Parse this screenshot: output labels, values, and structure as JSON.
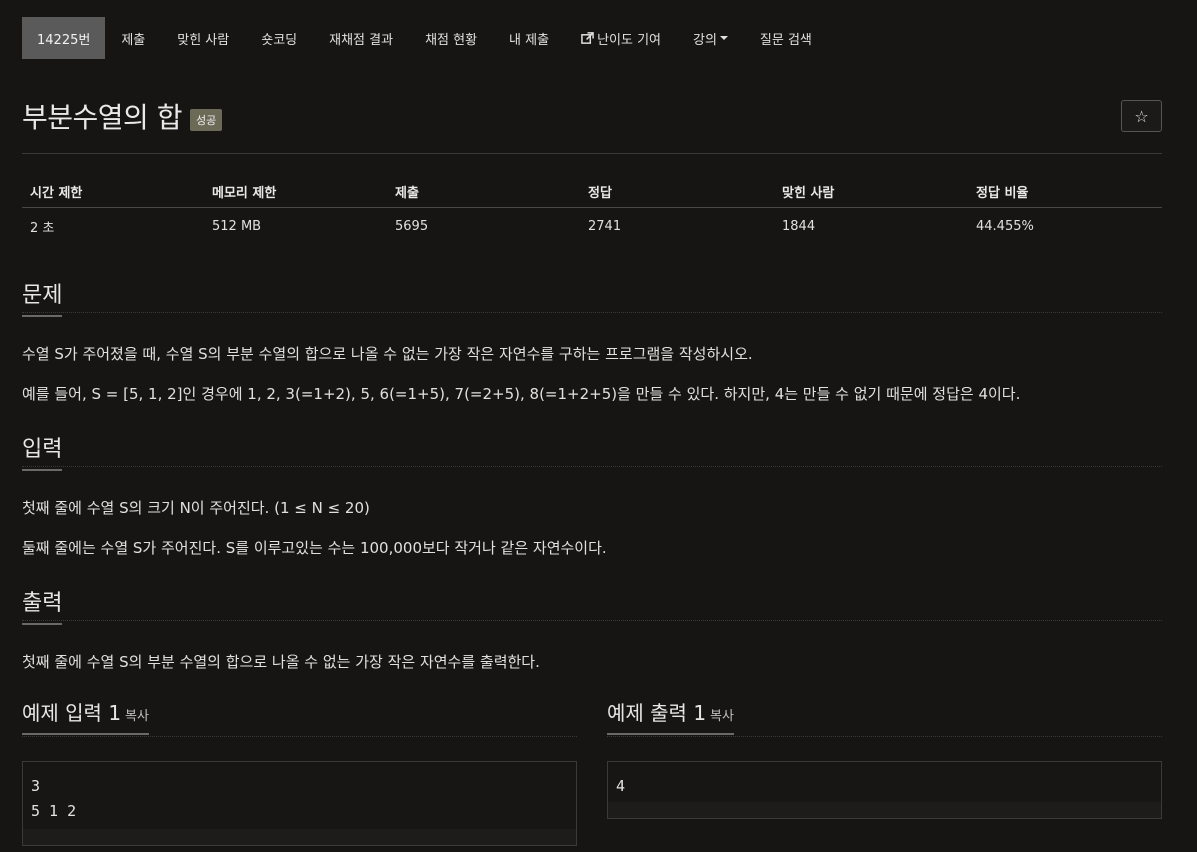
{
  "nav": {
    "items": [
      {
        "label": "14225번"
      },
      {
        "label": "제출"
      },
      {
        "label": "맞힌 사람"
      },
      {
        "label": "숏코딩"
      },
      {
        "label": "재채점 결과"
      },
      {
        "label": "채점 현황"
      },
      {
        "label": "내 제출"
      },
      {
        "label": "난이도 기여",
        "icon": "external-link-icon"
      },
      {
        "label": "강의",
        "icon": "caret-down-icon"
      },
      {
        "label": "질문 검색"
      }
    ]
  },
  "problem": {
    "title": "부분수열의 합",
    "badge": "성공",
    "star_icon": "☆"
  },
  "stats": {
    "headers": [
      "시간 제한",
      "메모리 제한",
      "제출",
      "정답",
      "맞힌 사람",
      "정답 비율"
    ],
    "values": [
      "2 초",
      "512 MB",
      "5695",
      "2741",
      "1844",
      "44.455%"
    ]
  },
  "sections": {
    "description": {
      "heading": "문제",
      "paragraphs": [
        "수열 S가 주어졌을 때, 수열 S의 부분 수열의 합으로 나올 수 없는 가장 작은 자연수를 구하는 프로그램을 작성하시오.",
        "예를 들어, S = [5, 1, 2]인 경우에 1, 2, 3(=1+2), 5, 6(=1+5), 7(=2+5), 8(=1+2+5)을 만들 수 있다. 하지만, 4는 만들 수 없기 때문에 정답은 4이다."
      ]
    },
    "input": {
      "heading": "입력",
      "paragraphs": [
        "첫째 줄에 수열 S의 크기 N이 주어진다. (1 ≤ N ≤ 20)",
        "둘째 줄에는 수열 S가 주어진다. S를 이루고있는 수는 100,000보다 작거나 같은 자연수이다."
      ]
    },
    "output": {
      "heading": "출력",
      "paragraphs": [
        "첫째 줄에 수열 S의 부분 수열의 합으로 나올 수 없는 가장 작은 자연수를 출력한다."
      ]
    }
  },
  "samples": {
    "input": {
      "heading": "예제 입력 1",
      "copy_label": "복사",
      "content": "3\n5 1 2"
    },
    "output": {
      "heading": "예제 출력 1",
      "copy_label": "복사",
      "content": "4"
    }
  }
}
